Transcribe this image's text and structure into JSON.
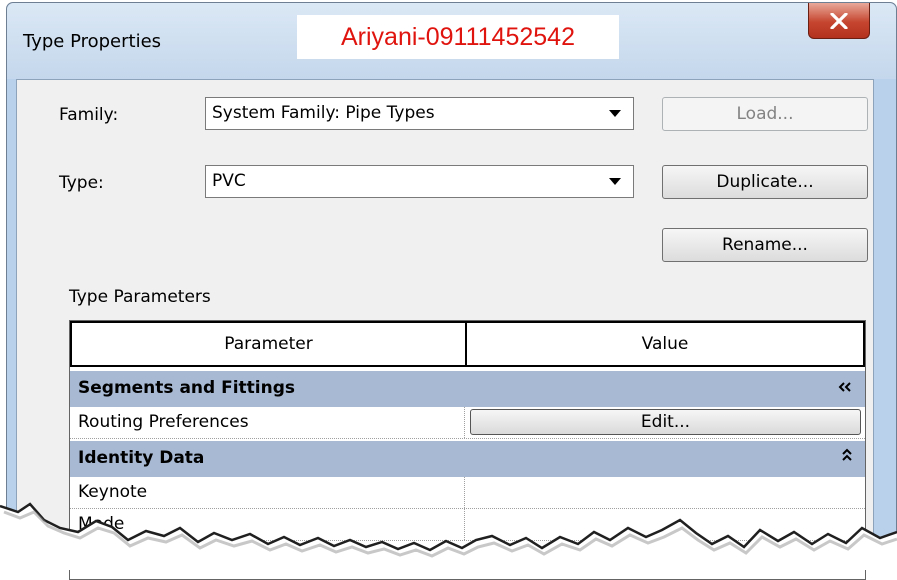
{
  "window": {
    "title": "Type Properties",
    "watermark": "Ariyani-09111452542",
    "close_glyph": "X"
  },
  "form": {
    "family_label": "Family:",
    "family_value": "System Family: Pipe Types",
    "type_label": "Type:",
    "type_value": "PVC",
    "load_button": "Load...",
    "duplicate_button": "Duplicate...",
    "rename_button": "Rename...",
    "type_parameters_label": "Type Parameters"
  },
  "grid": {
    "columns": [
      "Parameter",
      "Value"
    ],
    "groups": [
      {
        "label": "Segments and Fittings",
        "collapse_glyph": "»",
        "rows": [
          {
            "parameter": "Routing Preferences",
            "value_button": "Edit..."
          }
        ]
      },
      {
        "label": "Identity Data",
        "collapse_glyph": "»",
        "rows": [
          {
            "parameter": "Keynote",
            "value": ""
          },
          {
            "parameter": "Mode",
            "value": ""
          }
        ]
      }
    ]
  },
  "icons": {
    "close": "close-icon",
    "dropdown": "chevron-down-icon",
    "collapse": "double-chevron-up-icon"
  },
  "colors": {
    "watermark_text": "#e0140f",
    "group_row_bg": "#a7b9d3",
    "close_button": "#c5452f",
    "window_frame": "#b9d1ea"
  }
}
